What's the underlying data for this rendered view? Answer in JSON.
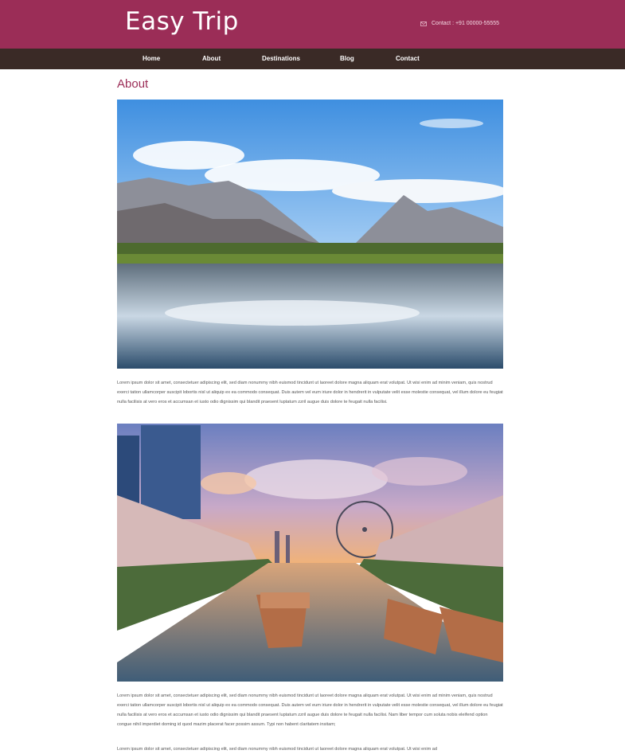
{
  "header": {
    "logo": "Easy Trip",
    "contact": "Contact : +91 00000-55555",
    "mail_icon": "mail-icon",
    "background": "#9b2d57"
  },
  "nav": {
    "background": "#3a2a26",
    "items": [
      {
        "label": "Home"
      },
      {
        "label": "About"
      },
      {
        "label": "Destinations"
      },
      {
        "label": "Blog"
      },
      {
        "label": "Contact"
      }
    ]
  },
  "main": {
    "title": "About",
    "para1": "Lorem ipsum dolor sit amet, consectetuer adipiscing elit, sed diam nonummy nibh euismod tincidunt ut laoreet dolore magna aliquam erat volutpat. Ut wisi enim ad minim veniam, quis nostrud exerci tation ullamcorper suscipit lobortis nisl ut aliquip ex ea commodo consequat. Duis autem vel eum iriure dolor in hendrerit in vulputate velit esse molestie consequat, vel illum dolore eu feugiat nulla facilisis at vero eros et accumsan et iusto odio dignissim qui blandit praesent luptatum zzril augue duis dolore te feugait nulla facilisi.",
    "para2": "Lorem ipsum dolor sit amet, consectetuer adipiscing elit, sed diam nonummy nibh euismod tincidunt ut laoreet dolore magna aliquam erat volutpat. Ut wisi enim ad minim veniam, quis nostrud exerci tation ullamcorper suscipit lobortis nisl ut aliquip ex ea commodo consequat. Duis autem vel eum iriure dolor in hendrerit in vulputate velit esse molestie consequat, vel illum dolore eu feugiat nulla facilisis at vero eros et accumsan et iusto odio dignissim qui blandit praesent luptatum zzril augue duis dolore te feugait nulla facilisi. Nam liber tempor cum soluta nobis eleifend option congue nihil imperdiet doming id quod mazim placerat facer possim assum. Typi non habent claritatem insitam;",
    "para3": "Lorem ipsum dolor sit amet, consectetuer adipiscing elit, sed diam nonummy nibh euismod tincidunt ut laoreet dolore magna aliquam erat volutpat. Ut wisi enim ad"
  }
}
